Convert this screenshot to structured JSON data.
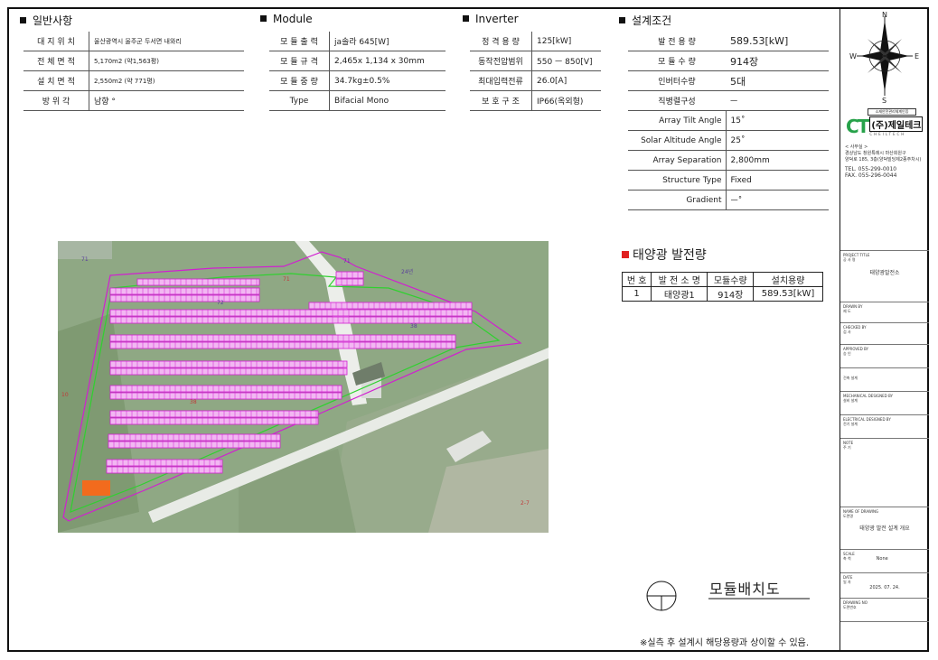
{
  "general": {
    "title": "일반사항",
    "rows": [
      {
        "label": "대 지 위 치",
        "value": "울산광역시 울주군 두서면 내와리"
      },
      {
        "label": "전 체 면 적",
        "value": "5,170m2 (약1,563평)"
      },
      {
        "label": "설 치 면 적",
        "value": "2,550m2 (약 771평)"
      },
      {
        "label": "방 위 각",
        "value": "남향 °"
      }
    ]
  },
  "module": {
    "title": "Module",
    "rows": [
      {
        "label": "모 듈 출 력",
        "value": "ja솔라 645[W]"
      },
      {
        "label": "모 듈 규 격",
        "value": "2,465x 1,134 x 30mm"
      },
      {
        "label": "모 듈 중 량",
        "value": "34.7kg±0.5%"
      },
      {
        "label": "Type",
        "value": "Bifacial Mono"
      }
    ]
  },
  "inverter": {
    "title": "Inverter",
    "rows": [
      {
        "label": "정 격 용 량",
        "value": "125[kW]"
      },
      {
        "label": "동작전압범위",
        "value": "550 ㅡ 850[V]"
      },
      {
        "label": "최대입력전류",
        "value": "26.0[A]"
      },
      {
        "label": "보 호 구 조",
        "value": "IP66(옥외형)"
      }
    ]
  },
  "design": {
    "title": "설계조건",
    "rows": [
      {
        "label": "발 전 용 량",
        "value": "589.53[kW]"
      },
      {
        "label": "모 듈 수 량",
        "value": "914장"
      },
      {
        "label": "인버터수량",
        "value": "5대"
      },
      {
        "label": "직병렬구성",
        "value": "ㅡ"
      },
      {
        "label": "Array Tilt Angle",
        "value": "15˚"
      },
      {
        "label": "Solar Altitude Angle",
        "value": "25˚"
      },
      {
        "label": "Array Separation",
        "value": "2,800mm"
      },
      {
        "label": "Structure Type",
        "value": "Fixed"
      },
      {
        "label": "Gradient",
        "value": "ㅡ˚"
      }
    ]
  },
  "generation": {
    "title": "태양광 발전량",
    "headers": [
      "번 호",
      "발 전 소 명",
      "모듈수량",
      "설치용량"
    ],
    "rows": [
      [
        "1",
        "태양광1",
        "914장",
        "589.53[kW]"
      ]
    ]
  },
  "compass": {
    "n": "N",
    "s": "S",
    "e": "E",
    "w": "W"
  },
  "company": {
    "logo_text": "(주)제일테크",
    "logo_sub": "CHEILTECH",
    "logo_top": "소재안전관리체계인증",
    "office": "< 사무실 >",
    "address1": "경상남도 창원특례시 마산회원구",
    "address2": "양덕로 185, 3층(양덕빌딩제2종주차시)",
    "tel": "TEL. 055-299-0010",
    "fax": "FAX. 055-296-0044"
  },
  "titleblock": {
    "project_title_en": "PROJECT TITLE",
    "project_title_ko": "공 사 명",
    "project_title_value": "태양광발전소",
    "drawn_en": "DRAWN BY",
    "drawn_ko": "제 도",
    "checked_en": "CHECKED BY",
    "checked_ko": "검 사",
    "approved_en": "APPROVED BY",
    "approved_ko": "승 인",
    "arch": "건축 설계",
    "mech_en": "MECHANICAL DESIGNED BY",
    "mech_ko": "설비 설계",
    "elec_en": "ELECTRICAL DESIGNED BY",
    "elec_ko": "전기 설계",
    "note_en": "NOTE",
    "note_ko": "주 기",
    "name_en": "NAME OF DRAWING",
    "name_ko": "도면명",
    "name_value": "태양광 발전 설계 개요",
    "scale_en": "SCALE",
    "scale_ko": "축 척",
    "scale_value": "None",
    "date_en": "DATE",
    "date_ko": "일 자",
    "date_value": "2025. 07. 24.",
    "dwgno_en": "DRAWING NO",
    "dwgno_ko": "도면번호"
  },
  "map": {
    "parcel_labels": [
      "71",
      "71",
      "71",
      "24년",
      "10",
      "38",
      "38",
      "2-7",
      "72"
    ]
  },
  "plan_title": "모듈배치도",
  "footer_note": "※실측 후 설계시 해당용량과 상이할 수 있음."
}
